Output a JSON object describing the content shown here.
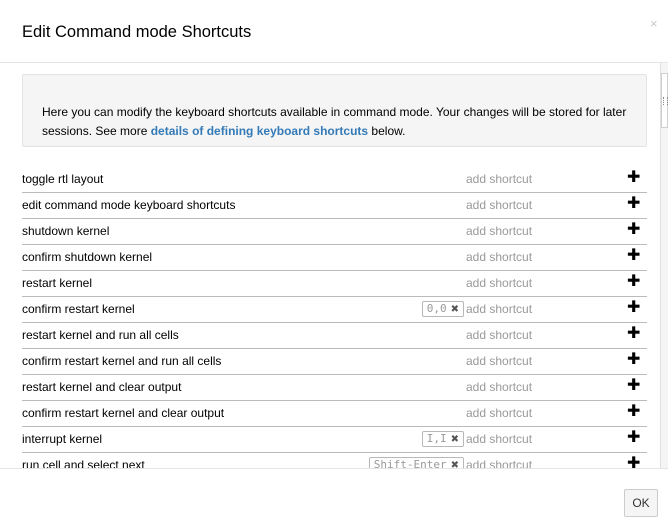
{
  "dialog": {
    "title": "Edit Command mode Shortcuts",
    "close_glyph": "×"
  },
  "intro": {
    "text_before": "Here you can modify the keyboard shortcuts available in command mode. Your changes will be stored for later sessions. See more ",
    "link_text": "details of defining keyboard shortcuts",
    "text_after": " below."
  },
  "shortcut_rows": [
    {
      "label": "toggle rtl layout",
      "existing": "",
      "add": "add shortcut"
    },
    {
      "label": "edit command mode keyboard shortcuts",
      "existing": "",
      "add": "add shortcut"
    },
    {
      "label": "shutdown kernel",
      "existing": "",
      "add": "add shortcut"
    },
    {
      "label": "confirm shutdown kernel",
      "existing": "",
      "add": "add shortcut"
    },
    {
      "label": "restart kernel",
      "existing": "",
      "add": "add shortcut"
    },
    {
      "label": "confirm restart kernel",
      "existing": "0,0",
      "add": "add shortcut"
    },
    {
      "label": "restart kernel and run all cells",
      "existing": "",
      "add": "add shortcut"
    },
    {
      "label": "confirm restart kernel and run all cells",
      "existing": "",
      "add": "add shortcut"
    },
    {
      "label": "restart kernel and clear output",
      "existing": "",
      "add": "add shortcut"
    },
    {
      "label": "confirm restart kernel and clear output",
      "existing": "",
      "add": "add shortcut"
    },
    {
      "label": "interrupt kernel",
      "existing": "I,I",
      "add": "add shortcut"
    },
    {
      "label": "run cell and select next",
      "existing": "Shift-Enter",
      "add": "add shortcut"
    }
  ],
  "icons": {
    "remove": "remove-icon",
    "add": "plus-icon",
    "close": "close-icon"
  },
  "remove_glyph": "✖",
  "plus_glyph": "✚",
  "footer": {
    "ok_label": "OK"
  }
}
